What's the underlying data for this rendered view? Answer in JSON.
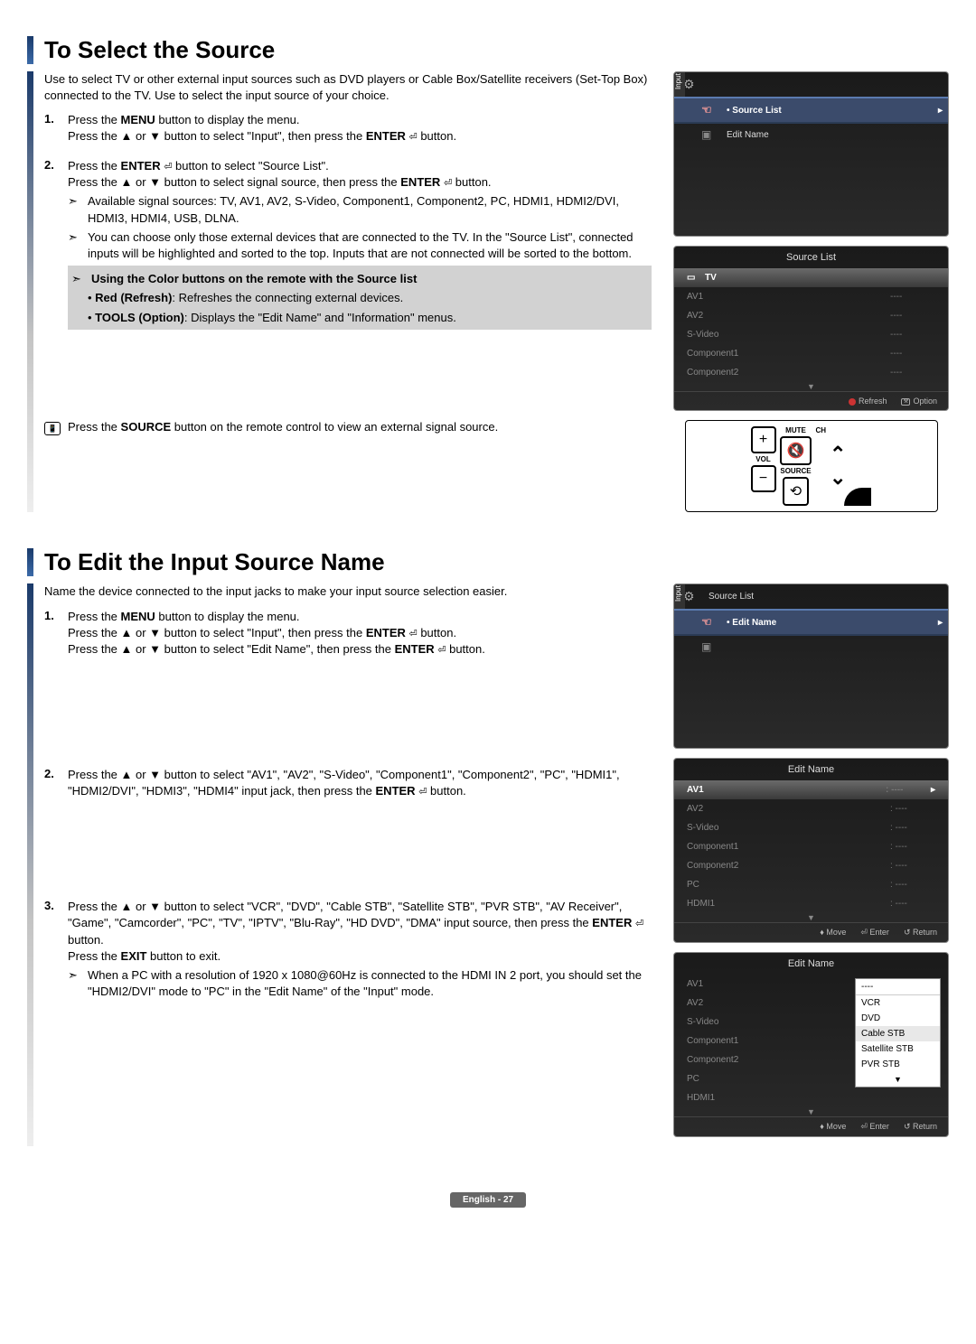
{
  "headings": {
    "select": "To Select the Source",
    "edit": "To Edit the Input Source Name"
  },
  "intro": {
    "select": "Use to select TV or other external input sources such as DVD players or Cable Box/Satellite receivers (Set-Top Box) connected to the TV. Use to select the input source of your choice.",
    "edit": "Name the device connected to the input jacks to make your input source selection easier."
  },
  "steps_select": {
    "s1a": "Press the ",
    "s1a_b": "MENU",
    "s1a2": " button to display the menu.",
    "s1b": "Press the ▲ or ▼ button to select \"Input\", then press the ",
    "s1b_b": "ENTER",
    "s1b2": " button.",
    "s2a": "Press the ",
    "s2a_b": "ENTER",
    "s2a2": " button to select \"Source List\".",
    "s2b": "Press the ▲ or ▼ button to select signal source, then press the ",
    "s2b_b": "ENTER",
    "s2b2": " button.",
    "bullet1": "Available signal sources: TV, AV1, AV2, S-Video, Component1, Component2, PC, HDMI1, HDMI2/DVI, HDMI3, HDMI4, USB, DLNA.",
    "bullet2": "You can choose only those external devices that are connected to the TV. In the \"Source List\", connected inputs will be highlighted and sorted to the top. Inputs that are not connected will be sorted to the bottom.",
    "bullet3": "Using the Color buttons on the remote with the Source list",
    "grey1_b": "Red (Refresh)",
    "grey1": ": Refreshes the connecting external devices.",
    "grey2_b": "TOOLS (Option)",
    "grey2": ": Displays the \"Edit Name\" and \"Information\" menus.",
    "remote": "Press the ",
    "remote_b": "SOURCE",
    "remote2": " button on the remote control to view an external signal source."
  },
  "steps_edit": {
    "s1a": "Press the ",
    "s1a_b": "MENU",
    "s1a2": " button to display the menu.",
    "s1b": "Press the ▲ or ▼ button to select \"Input\", then press the ",
    "s1b_b": "ENTER",
    "s1b2": " button.",
    "s1c": "Press the ▲ or ▼ button to select \"Edit Name\", then press the ",
    "s1c_b": "ENTER",
    "s1c2": " button.",
    "s2a": "Press the ▲ or ▼ button to select \"AV1\", \"AV2\", \"S-Video\", \"Component1\", \"Component2\", \"PC\", \"HDMI1\", \"HDMI2/DVI\", \"HDMI3\", \"HDMI4\" input jack, then press the ",
    "s2a_b": "ENTER",
    "s2a2": " button.",
    "s3a": "Press the ▲ or ▼ button to select \"VCR\", \"DVD\", \"Cable STB\", \"Satellite STB\", \"PVR STB\", \"AV Receiver\", \"Game\", \"Camcorder\", \"PC\", \"TV\", \"IPTV\", \"Blu-Ray\", \"HD DVD\", \"DMA\" input source, then press the ",
    "s3a_b": "ENTER",
    "s3a2": " button.",
    "s3b": "Press the ",
    "s3b_b": "EXIT",
    "s3b2": " button to exit.",
    "bullet": "When a PC with a resolution of 1920 x 1080@60Hz is connected to the HDMI IN 2 port, you should set the \"HDMI2/DVI\" mode to \"PC\" in the \"Edit Name\" of the \"Input\" mode."
  },
  "osd": {
    "input_tab": "Input",
    "source_list": "Source List",
    "edit_name": "Edit Name",
    "tv": "TV",
    "sources": [
      "AV1",
      "AV2",
      "S-Video",
      "Component1",
      "Component2"
    ],
    "dash": "----",
    "refresh": "Refresh",
    "option": "Option",
    "edit_sources": [
      "AV1",
      "AV2",
      "S-Video",
      "Component1",
      "Component2",
      "PC",
      "HDMI1"
    ],
    "colon_dash": ": ----",
    "move": "Move",
    "enter": "Enter",
    "return": "Return",
    "dropdown": [
      "----",
      "VCR",
      "DVD",
      "Cable STB",
      "Satellite STB",
      "PVR STB"
    ]
  },
  "remote": {
    "mute": "MUTE",
    "vol": "VOL",
    "source": "SOURCE",
    "ch": "CH"
  },
  "footer": "English - 27",
  "glyph": {
    "enter": "⏎",
    "arrow": "➣",
    "remote_icon": "📱"
  }
}
